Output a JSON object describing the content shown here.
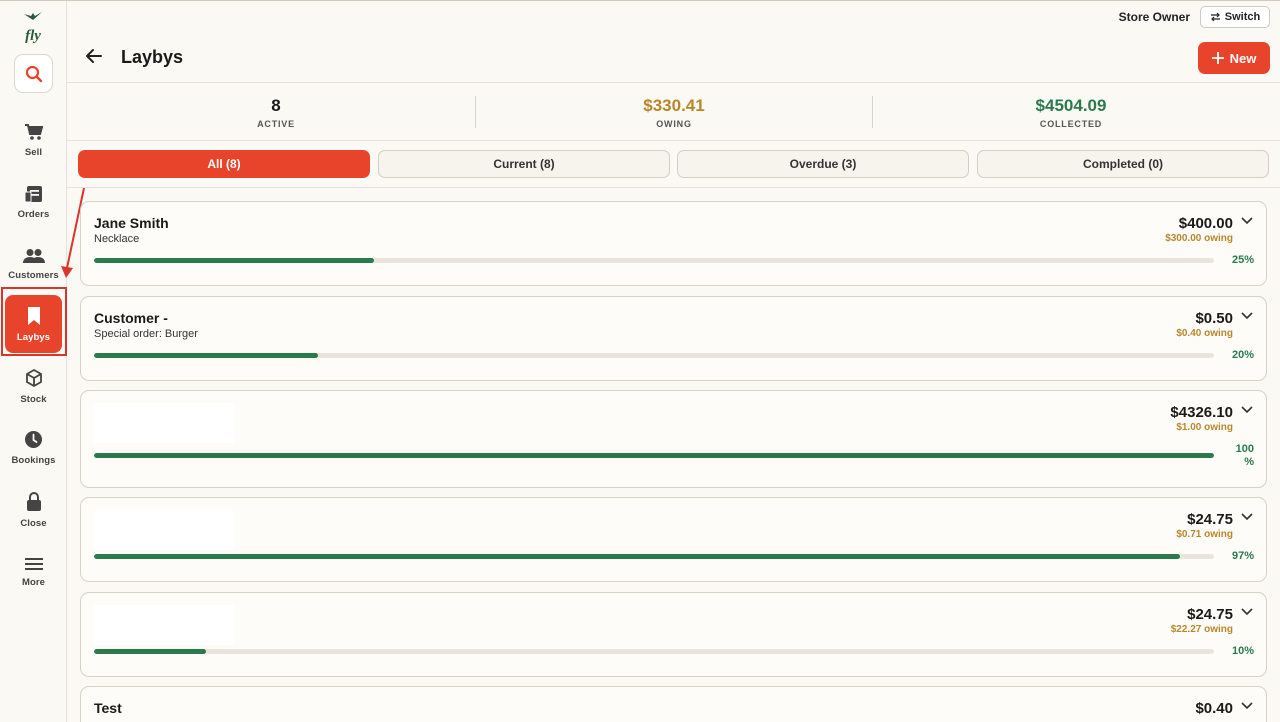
{
  "app": {
    "logo_text": "fly"
  },
  "topbar": {
    "user": "Store Owner",
    "switch_label": "Switch"
  },
  "header": {
    "title": "Laybys",
    "new_label": "New"
  },
  "sidebar": {
    "items": [
      {
        "label": "Sell",
        "icon": "cart-icon"
      },
      {
        "label": "Orders",
        "icon": "orders-icon"
      },
      {
        "label": "Customers",
        "icon": "customers-icon"
      },
      {
        "label": "Laybys",
        "icon": "bookmark-icon",
        "active": true
      },
      {
        "label": "Stock",
        "icon": "box-icon"
      },
      {
        "label": "Bookings",
        "icon": "clock-icon"
      },
      {
        "label": "Close",
        "icon": "lock-icon"
      },
      {
        "label": "More",
        "icon": "menu-icon"
      }
    ]
  },
  "stats": [
    {
      "value": "8",
      "caption": "ACTIVE",
      "color": "#1a1a1a"
    },
    {
      "value": "$330.41",
      "caption": "OWING",
      "color": "#b8862a"
    },
    {
      "value": "$4504.09",
      "caption": "COLLECTED",
      "color": "#2a7a4d"
    }
  ],
  "tabs": [
    {
      "label": "All (8)",
      "active": true
    },
    {
      "label": "Current (8)"
    },
    {
      "label": "Overdue (3)"
    },
    {
      "label": "Completed (0)"
    }
  ],
  "laybys": [
    {
      "name": "Jane Smith",
      "desc": "Necklace",
      "amount": "$400.00",
      "owing": "$300.00 owing",
      "progress": 0.25,
      "pct": "25%"
    },
    {
      "name": "Customer -",
      "desc": "Special order: Burger",
      "amount": "$0.50",
      "owing": "$0.40 owing",
      "progress": 0.2,
      "pct": "20%"
    },
    {
      "name": "",
      "desc": "",
      "amount": "$4326.10",
      "owing": "$1.00 owing",
      "progress": 1.0,
      "pct": "100 %"
    },
    {
      "name": "",
      "desc": "",
      "amount": "$24.75",
      "owing": "$0.71 owing",
      "progress": 0.97,
      "pct": "97%"
    },
    {
      "name": "",
      "desc": "",
      "amount": "$24.75",
      "owing": "$22.27 owing",
      "progress": 0.1,
      "pct": "10%"
    },
    {
      "name": "Test",
      "desc": "",
      "amount": "$0.40",
      "owing": "",
      "progress": 0,
      "pct": ""
    }
  ],
  "colors": {
    "accent": "#e8442c",
    "progress": "#2a7a4d",
    "owing": "#b8862a"
  }
}
